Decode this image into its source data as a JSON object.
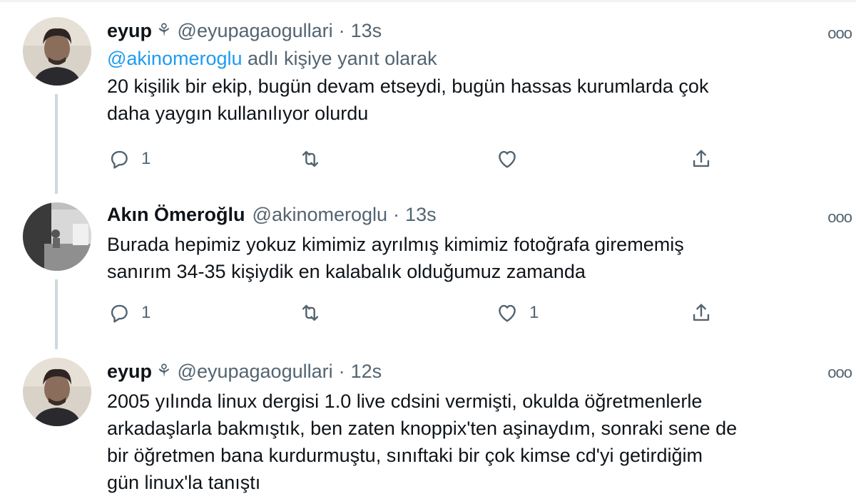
{
  "tweets": [
    {
      "name": "eyup",
      "badge": "⚘",
      "handle": "@eyupagaogullari",
      "separator": "·",
      "time": "13s",
      "reply_prefix": "@akinomeroglu",
      "reply_suffix": " adlı kişiye yanıt olarak",
      "text_line1": "20 kişilik bir ekip, bugün devam etseydi, bugün hassas kurumlarda çok",
      "text_line2": "daha yaygın kullanılıyor olurdu",
      "reply_count": "1",
      "retweet_count": "",
      "like_count": ""
    },
    {
      "name": "Akın Ömeroğlu",
      "handle": "@akinomeroglu",
      "separator": "·",
      "time": "13s",
      "text_line1": "Burada hepimiz yokuz kimimiz ayrılmış kimimiz fotoğrafa girememiş",
      "text_line2": "sanırım 34-35 kişiydik en kalabalık olduğumuz zamanda",
      "reply_count": "1",
      "retweet_count": "",
      "like_count": "1"
    },
    {
      "name": "eyup",
      "badge": "⚘",
      "handle": "@eyupagaogullari",
      "separator": "·",
      "time": "12s",
      "text_line1": "2005 yılında linux dergisi 1.0 live cdsini vermişti, okulda öğretmenlerle",
      "text_line2": "arkadaşlarla bakmıştık, ben zaten knoppix'ten aşinaydım, sonraki sene de",
      "text_line3": "bir öğretmen bana kurdurmuştu, sınıftaki bir çok kimse cd'yi getirdiğim",
      "text_line4": "gün linux'la tanıştı"
    }
  ],
  "more_label": "ooo",
  "colors": {
    "accent": "#1d9bf0",
    "secondary": "#536471",
    "thread_line": "#cfd9de"
  }
}
